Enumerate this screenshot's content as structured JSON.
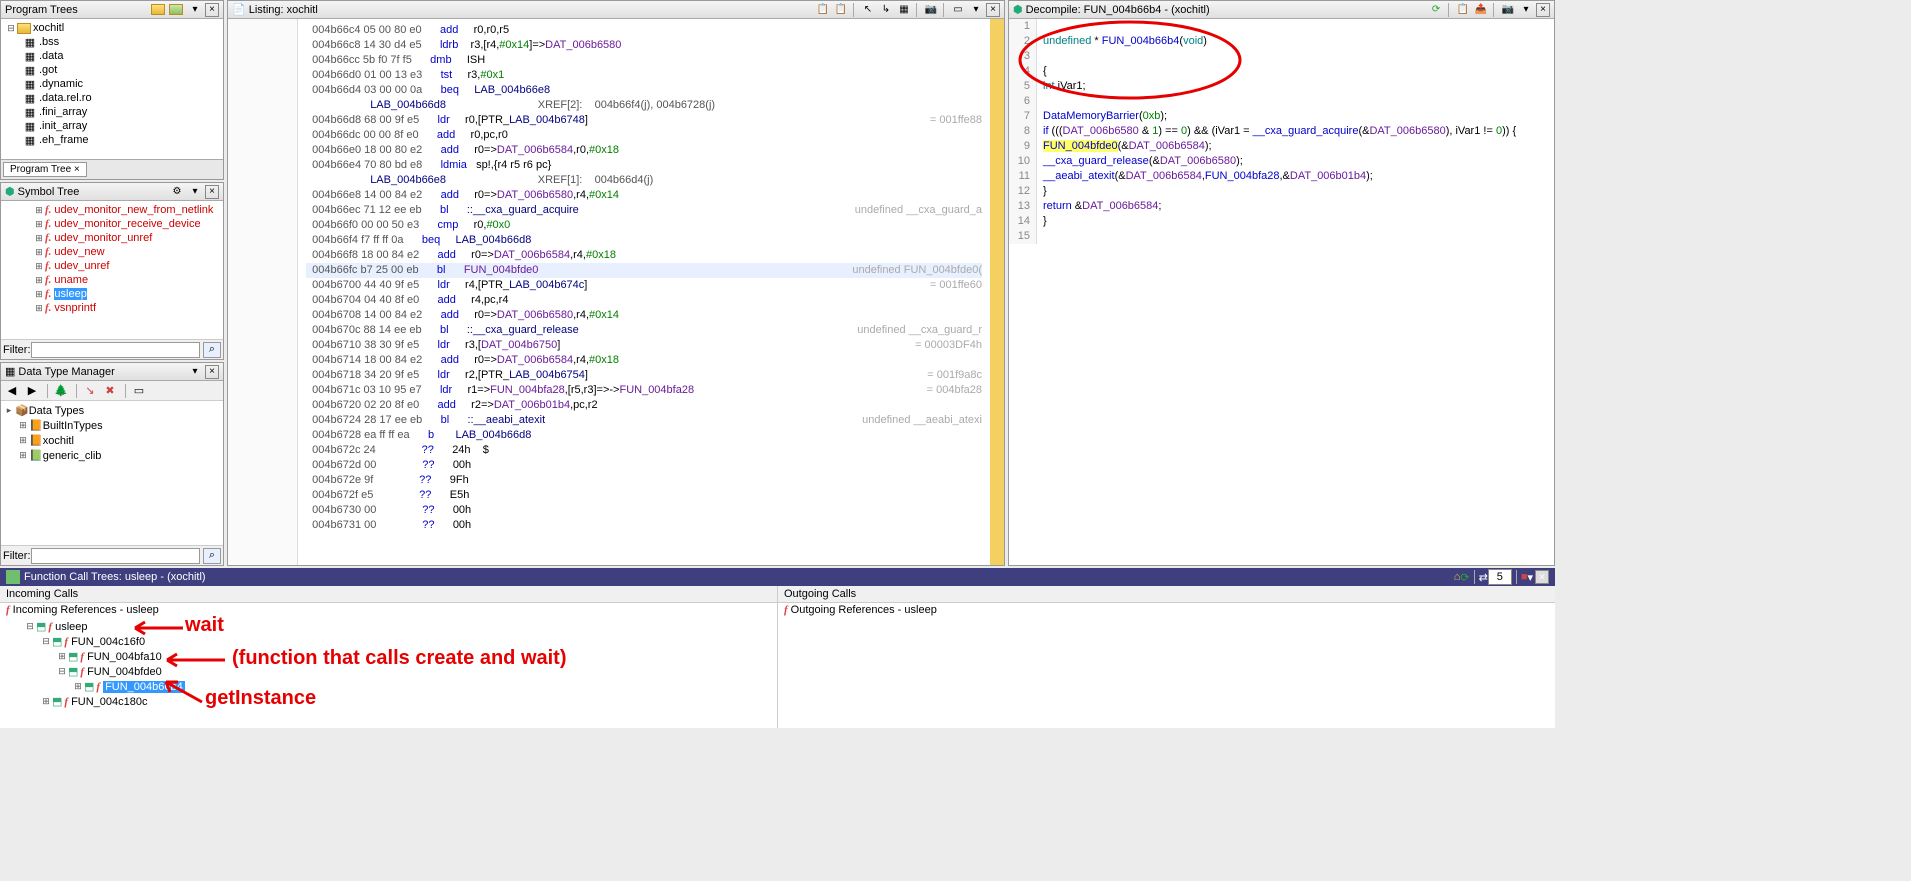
{
  "programTrees": {
    "title": "Program Trees",
    "rootName": "xochitl",
    "sections": [
      ".bss",
      ".data",
      ".got",
      ".dynamic",
      ".data.rel.ro",
      ".fini_array",
      ".init_array",
      ".eh_frame"
    ],
    "tabLabel": "Program Tree  ×"
  },
  "symbolTree": {
    "title": "Symbol Tree",
    "items": [
      {
        "label": "udev_monitor_new_from_netlink",
        "red": true
      },
      {
        "label": "udev_monitor_receive_device",
        "red": true
      },
      {
        "label": "udev_monitor_unref",
        "red": true
      },
      {
        "label": "udev_new",
        "red": true
      },
      {
        "label": "udev_unref",
        "red": true
      },
      {
        "label": "uname",
        "red": true
      },
      {
        "label": "usleep",
        "red": true,
        "selected": true
      },
      {
        "label": "vsnprintf",
        "red": true
      }
    ],
    "filterLabel": "Filter:"
  },
  "dataTypeMgr": {
    "title": "Data Type Manager",
    "root": "Data Types",
    "items": [
      "BuiltInTypes",
      "xochitl",
      "generic_clib"
    ],
    "filterLabel": "Filter:"
  },
  "listing": {
    "title": "Listing:",
    "file": "xochitl",
    "rows": [
      {
        "a": "004b66c4",
        "b": "05 00 80 e0",
        "m": "add",
        "o": "r0,r0,r5"
      },
      {
        "a": "004b66c8",
        "b": "14 30 d4 e5",
        "m": "ldrb",
        "o": "r3,[r4,#0x14]=>DAT_006b6580"
      },
      {
        "a": "004b66cc",
        "b": "5b f0 7f f5",
        "m": "dmb",
        "o": "ISH"
      },
      {
        "a": "004b66d0",
        "b": "01 00 13 e3",
        "m": "tst",
        "o": "r3,#0x1"
      },
      {
        "a": "004b66d4",
        "b": "03 00 00 0a",
        "m": "beq",
        "o": "LAB_004b66e8"
      },
      {
        "lab": "LAB_004b66d8",
        "xref": "XREF[2]:    004b66f4(j), 004b6728(j)"
      },
      {
        "a": "004b66d8",
        "b": "68 00 9f e5",
        "m": "ldr",
        "o": "r0,[PTR_LAB_004b6748]",
        "side": "= 001ffe88"
      },
      {
        "a": "004b66dc",
        "b": "00 00 8f e0",
        "m": "add",
        "o": "r0,pc,r0"
      },
      {
        "a": "004b66e0",
        "b": "18 00 80 e2",
        "m": "add",
        "o": "r0=>DAT_006b6584,r0,#0x18"
      },
      {
        "a": "004b66e4",
        "b": "70 80 bd e8",
        "m": "ldmia",
        "o": "sp!,{r4 r5 r6 pc}"
      },
      {
        "lab": "LAB_004b66e8",
        "xref": "XREF[1]:    004b66d4(j)"
      },
      {
        "a": "004b66e8",
        "b": "14 00 84 e2",
        "m": "add",
        "o": "r0=>DAT_006b6580,r4,#0x14"
      },
      {
        "a": "004b66ec",
        "b": "71 12 ee eb",
        "m": "bl",
        "o": "<EXTERNAL>::__cxa_guard_acquire",
        "side": "undefined __cxa_guard_a"
      },
      {
        "a": "004b66f0",
        "b": "00 00 50 e3",
        "m": "cmp",
        "o": "r0,#0x0"
      },
      {
        "a": "004b66f4",
        "b": "f7 ff ff 0a",
        "m": "beq",
        "o": "LAB_004b66d8"
      },
      {
        "a": "004b66f8",
        "b": "18 00 84 e2",
        "m": "add",
        "o": "r0=>DAT_006b6584,r4,#0x18"
      },
      {
        "a": "004b66fc",
        "b": "b7 25 00 eb",
        "m": "bl",
        "o": "FUN_004bfde0",
        "side": "undefined FUN_004bfde0(",
        "hl": true
      },
      {
        "a": "004b6700",
        "b": "44 40 9f e5",
        "m": "ldr",
        "o": "r4,[PTR_LAB_004b674c]",
        "side": "= 001ffe60"
      },
      {
        "a": "004b6704",
        "b": "04 40 8f e0",
        "m": "add",
        "o": "r4,pc,r4"
      },
      {
        "a": "004b6708",
        "b": "14 00 84 e2",
        "m": "add",
        "o": "r0=>DAT_006b6580,r4,#0x14"
      },
      {
        "a": "004b670c",
        "b": "88 14 ee eb",
        "m": "bl",
        "o": "<EXTERNAL>::__cxa_guard_release",
        "side": "undefined __cxa_guard_r"
      },
      {
        "a": "004b6710",
        "b": "38 30 9f e5",
        "m": "ldr",
        "o": "r3,[DAT_004b6750]",
        "side": "= 00003DF4h"
      },
      {
        "a": "004b6714",
        "b": "18 00 84 e2",
        "m": "add",
        "o": "r0=>DAT_006b6584,r4,#0x18"
      },
      {
        "a": "004b6718",
        "b": "34 20 9f e5",
        "m": "ldr",
        "o": "r2,[PTR_LAB_004b6754]",
        "side": "= 001f9a8c"
      },
      {
        "a": "004b671c",
        "b": "03 10 95 e7",
        "m": "ldr",
        "o": "r1=>FUN_004bfa28,[r5,r3]=>->FUN_004bfa28",
        "side": "= 004bfa28"
      },
      {
        "a": "004b6720",
        "b": "02 20 8f e0",
        "m": "add",
        "o": "r2=>DAT_006b01b4,pc,r2"
      },
      {
        "a": "004b6724",
        "b": "28 17 ee eb",
        "m": "bl",
        "o": "<EXTERNAL>::__aeabi_atexit",
        "side": "undefined __aeabi_atexi"
      },
      {
        "a": "004b6728",
        "b": "ea ff ff ea",
        "m": "b",
        "o": "LAB_004b66d8"
      },
      {
        "a": "004b672c",
        "b": "24",
        "m": "??",
        "o": "24h    $"
      },
      {
        "a": "004b672d",
        "b": "00",
        "m": "??",
        "o": "00h"
      },
      {
        "a": "004b672e",
        "b": "9f",
        "m": "??",
        "o": "9Fh"
      },
      {
        "a": "004b672f",
        "b": "e5",
        "m": "??",
        "o": "E5h"
      },
      {
        "a": "004b6730",
        "b": "00",
        "m": "??",
        "o": "00h"
      },
      {
        "a": "004b6731",
        "b": "00",
        "m": "??",
        "o": "00h"
      }
    ]
  },
  "decompile": {
    "title": "Decompile: FUN_004b66b4 - (xochitl)",
    "lines": [
      {
        "n": "1",
        "t": ""
      },
      {
        "n": "2",
        "t": "undefined * FUN_004b66b4(void)"
      },
      {
        "n": "3",
        "t": ""
      },
      {
        "n": "4",
        "t": "{"
      },
      {
        "n": "5",
        "t": "  int iVar1;"
      },
      {
        "n": "6",
        "t": ""
      },
      {
        "n": "7",
        "t": "  DataMemoryBarrier(0xb);"
      },
      {
        "n": "8",
        "t": "  if (((DAT_006b6580 & 1) == 0) && (iVar1 = __cxa_guard_acquire(&DAT_006b6580), iVar1 != 0)) {"
      },
      {
        "n": "9",
        "t": "    FUN_004bfde0(&DAT_006b6584);"
      },
      {
        "n": "10",
        "t": "    __cxa_guard_release(&DAT_006b6580);"
      },
      {
        "n": "11",
        "t": "    __aeabi_atexit(&DAT_006b6584,FUN_004bfa28,&DAT_006b01b4);"
      },
      {
        "n": "12",
        "t": "  }"
      },
      {
        "n": "13",
        "t": "  return &DAT_006b6584;"
      },
      {
        "n": "14",
        "t": "}"
      },
      {
        "n": "15",
        "t": ""
      }
    ]
  },
  "functionCallTrees": {
    "title": "Function Call Trees: usleep  -  (xochitl)",
    "incoming": {
      "header": "Incoming Calls",
      "rootLabel": "Incoming References - usleep",
      "tree": [
        {
          "d": 1,
          "exp": "⊟",
          "label": "usleep"
        },
        {
          "d": 2,
          "exp": "⊟",
          "label": "FUN_004c16f0"
        },
        {
          "d": 3,
          "exp": "⊞",
          "label": "FUN_004bfa10"
        },
        {
          "d": 3,
          "exp": "⊟",
          "label": "FUN_004bfde0"
        },
        {
          "d": 4,
          "exp": "⊞",
          "label": "FUN_004b66b4",
          "selected": true
        },
        {
          "d": 2,
          "exp": "⊞",
          "label": "FUN_004c180c"
        }
      ]
    },
    "outgoing": {
      "header": "Outgoing Calls",
      "rootLabel": "Outgoing References - usleep"
    },
    "spinValue": "5"
  },
  "annotations": {
    "wait": "wait",
    "middle": "(function that calls create and wait)",
    "getInstance": "getInstance"
  }
}
